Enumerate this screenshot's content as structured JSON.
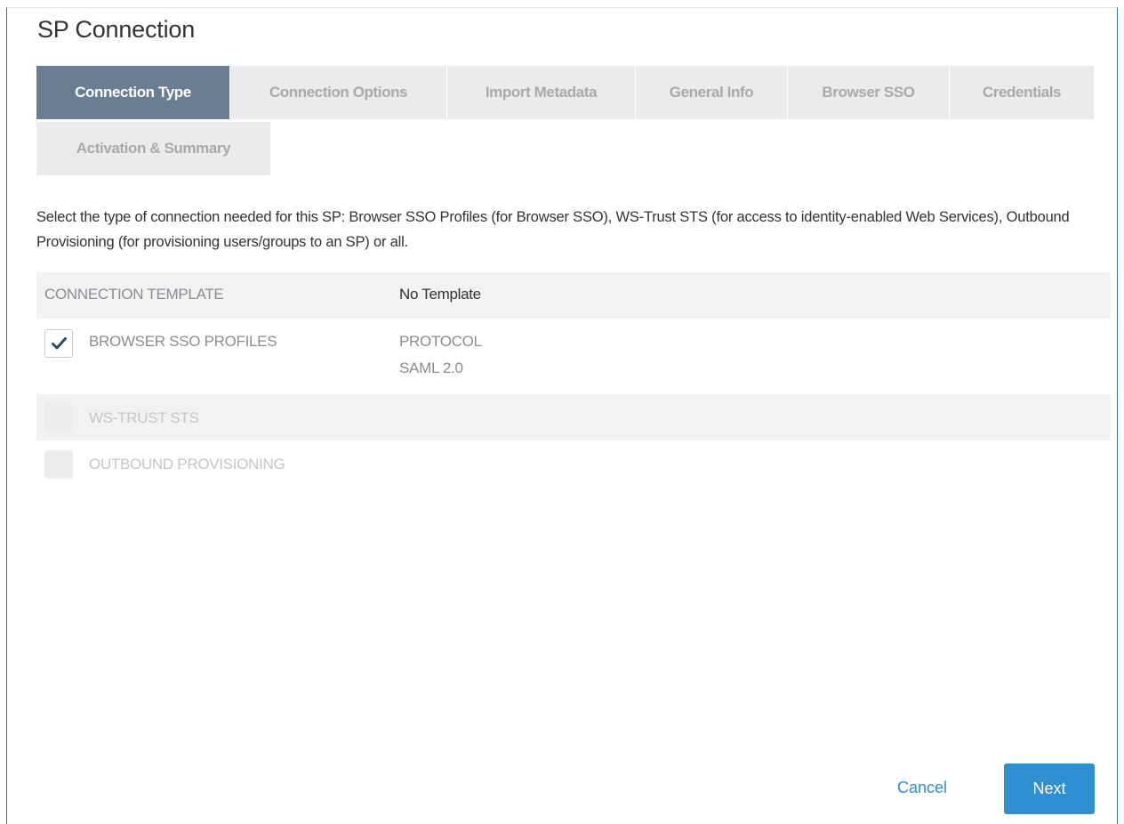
{
  "page": {
    "title": "SP Connection"
  },
  "tabs": [
    {
      "label": "Connection Type",
      "active": true
    },
    {
      "label": "Connection Options",
      "active": false
    },
    {
      "label": "Import Metadata",
      "active": false
    },
    {
      "label": "General Info",
      "active": false
    },
    {
      "label": "Browser SSO",
      "active": false
    },
    {
      "label": "Credentials",
      "active": false
    },
    {
      "label": "Activation & Summary",
      "active": false
    }
  ],
  "description": "Select the type of connection needed for this SP: Browser SSO Profiles (for Browser SSO), WS-Trust STS (for access to identity-enabled Web Services), Outbound Provisioning (for provisioning users/groups to an SP) or all.",
  "template": {
    "label": "CONNECTION TEMPLATE",
    "value": "No Template"
  },
  "options": {
    "browser_sso": {
      "label": "BROWSER SSO PROFILES",
      "checked": true,
      "protocol_label": "PROTOCOL",
      "protocol_value": "SAML 2.0"
    },
    "ws_trust": {
      "label": "WS-TRUST STS",
      "checked": false,
      "disabled": true
    },
    "outbound": {
      "label": "OUTBOUND PROVISIONING",
      "checked": false,
      "disabled": true
    }
  },
  "footer": {
    "cancel_label": "Cancel",
    "next_label": "Next"
  },
  "colors": {
    "active_tab": "#6b7d93",
    "inactive_tab": "#ebebec",
    "primary_button": "#2f8fd0",
    "link": "#2b8fd0",
    "checkmark": "#2c4a6e"
  }
}
